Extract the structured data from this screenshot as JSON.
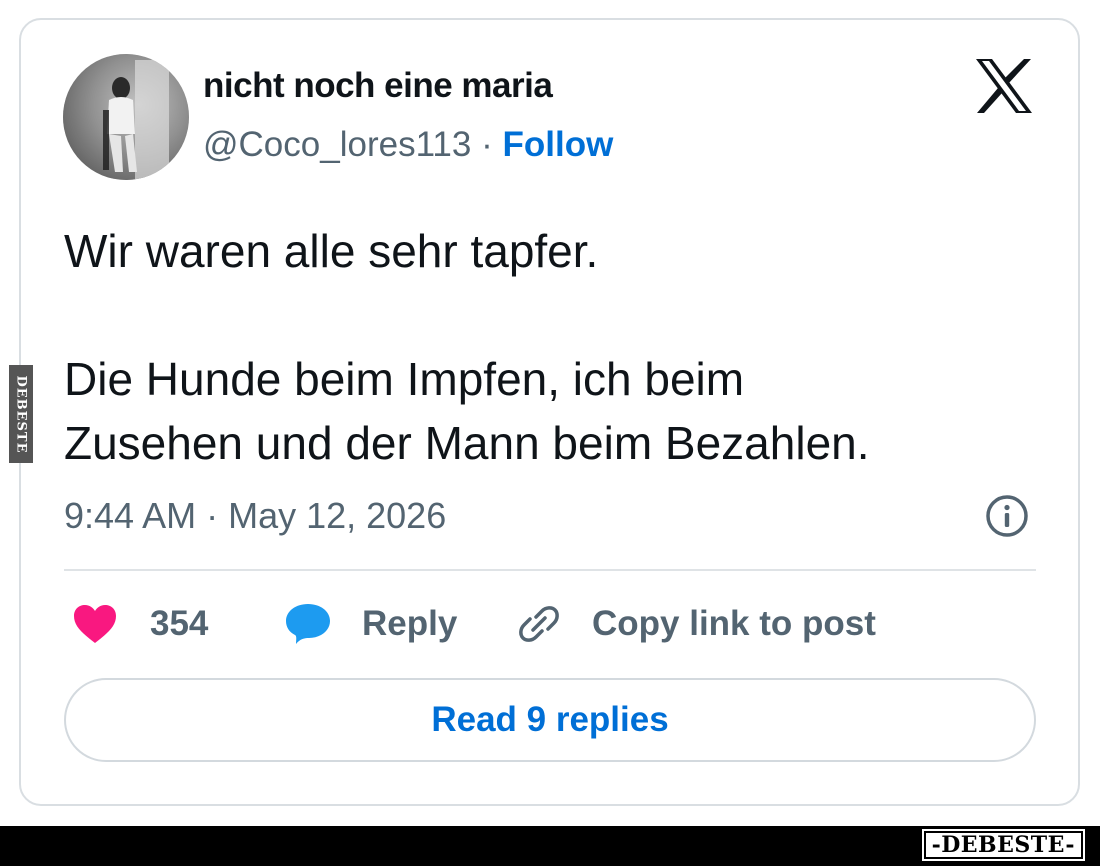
{
  "tweet": {
    "display_name": "nicht noch eine maria",
    "handle": "@Coco_lores113",
    "separator": " · ",
    "follow_label": "Follow",
    "text_line_1": "Wir waren alle sehr tapfer.",
    "text_line_2": "Die Hunde beim Impfen, ich beim",
    "text_line_3": "Zusehen und der Mann beim Bezahlen.",
    "timestamp": "9:44 AM · May 12, 2026",
    "like_count": "354",
    "reply_label": "Reply",
    "copy_link_label": "Copy link to post",
    "read_replies_label": "Read 9 replies"
  },
  "icons": {
    "platform_logo": "x-logo-icon",
    "info": "info-icon",
    "like": "heart-icon",
    "reply": "speech-bubble-icon",
    "copy_link": "link-icon"
  },
  "colors": {
    "heart": "#f91880",
    "reply_bubble": "#1d9bf0",
    "link_blue": "#006fd6",
    "muted_text": "#536471"
  },
  "watermarks": {
    "side": "DEBESTE",
    "bottom": "-DEBESTE-"
  }
}
